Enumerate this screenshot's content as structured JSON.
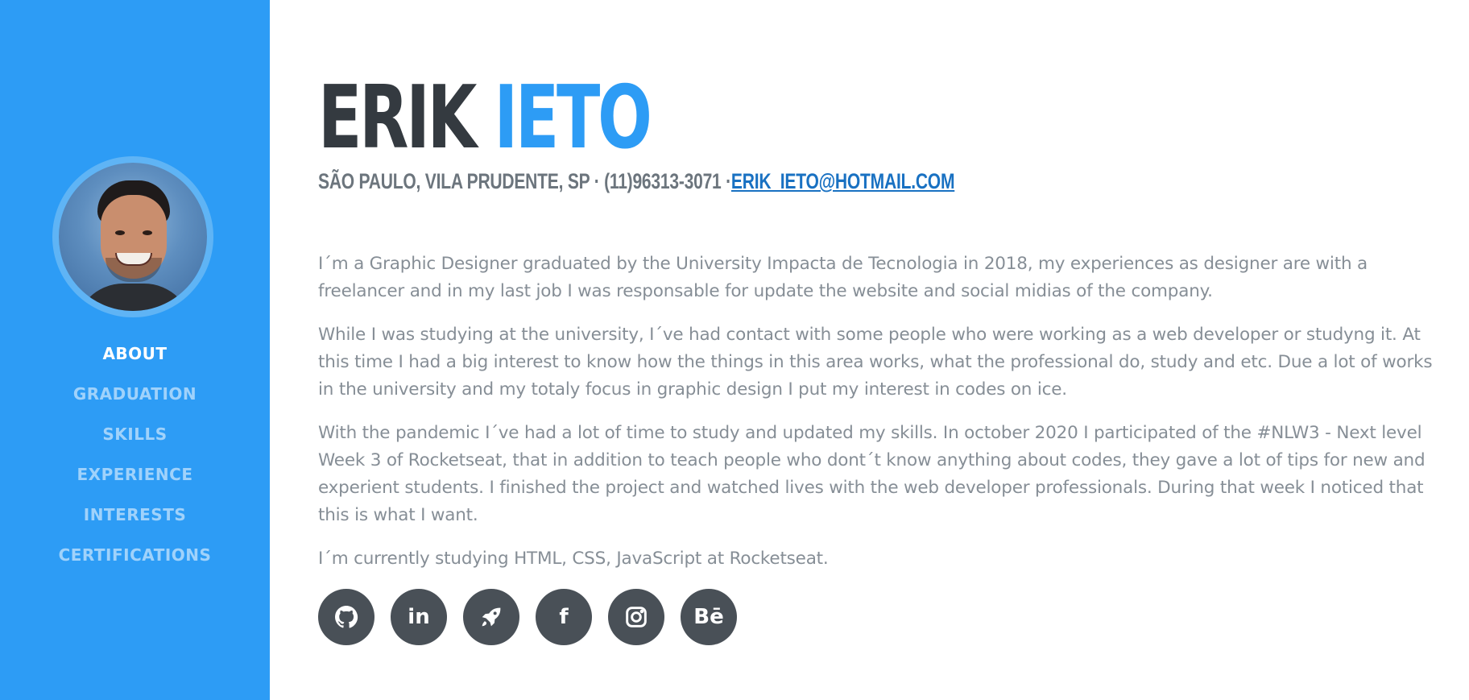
{
  "sidebar": {
    "nav": [
      {
        "label": "ABOUT",
        "active": true
      },
      {
        "label": "GRADUATION"
      },
      {
        "label": "SKILLS"
      },
      {
        "label": "EXPERIENCE"
      },
      {
        "label": "INTERESTS"
      },
      {
        "label": "CERTIFICATIONS"
      }
    ],
    "accent_color": "#2d9cf5"
  },
  "header": {
    "first_name": "ERIK",
    "last_name": "IETO",
    "contact": "SÃO PAULO, VILA PRUDENTE, SP · (11)96313-3071 ·",
    "email": "ERIK_IETO@HOTMAIL.COM"
  },
  "about": {
    "paragraphs": [
      "I´m a Graphic Designer graduated by the University Impacta de Tecnologia in 2018, my experiences as designer are with a freelancer and in my last job I was responsable for update the website and social midias of the company.",
      "While I was studying at the university, I´ve had contact with some people who were working as a web developer or studyng it. At this time I had a big interest to know how the things in this area works, what the professional do, study and etc. Due a lot of works in the university and my totaly focus in graphic design I put my interest in codes on ice.",
      "With the pandemic I´ve had a lot of time to study and updated my skills. In october 2020 I participated of the #NLW3 - Next level Week 3 of Rocketseat, that in addition to teach people who dont´t know anything about codes, they gave a lot of tips for new and experient students. I finished the project and watched lives with the web developer professionals. During that week I noticed that this is what I want.",
      "I´m currently studying HTML, CSS, JavaScript at Rocketseat."
    ]
  },
  "social": [
    {
      "icon": "github-icon"
    },
    {
      "icon": "linkedin-icon",
      "text": "in"
    },
    {
      "icon": "rocket-icon"
    },
    {
      "icon": "facebook-icon",
      "text": "f"
    },
    {
      "icon": "instagram-icon"
    },
    {
      "icon": "behance-icon",
      "text": "Bē"
    }
  ]
}
